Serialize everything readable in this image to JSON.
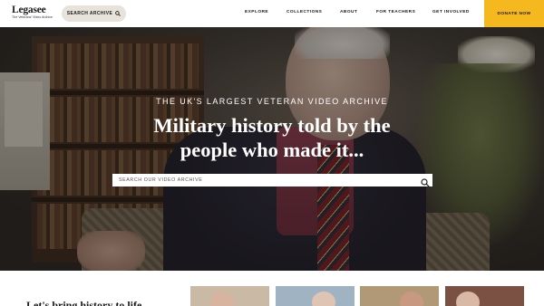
{
  "brand": {
    "name": "Legasee",
    "tagline": "The Veterans' Video Archive"
  },
  "header": {
    "search_label": "SEARCH ARCHIVE",
    "nav": [
      "EXPLORE",
      "COLLECTIONS",
      "ABOUT",
      "FOR TEACHERS",
      "GET INVOLVED"
    ],
    "donate_label": "DONATE NOW"
  },
  "hero": {
    "eyebrow": "THE UK'S LARGEST VETERAN VIDEO ARCHIVE",
    "title_line1": "Military history told by the",
    "title_line2": "people who made it...",
    "search_placeholder": "SEARCH OUR VIDEO ARCHIVE"
  },
  "intro": {
    "heading": "Let's bring history to life"
  },
  "thumbnails": [
    {
      "bg": "#c9b9a5",
      "face": "#d8b4a0"
    },
    {
      "bg": "#9fb3c2",
      "face": "#e0c4b3"
    },
    {
      "bg": "#b19876",
      "face": "#c99880"
    },
    {
      "bg": "#7b5144",
      "face": "#d9b9a6"
    }
  ],
  "colors": {
    "accent": "#f5b81f",
    "pill": "#e8e3da"
  },
  "icons": {
    "search": "search-icon"
  }
}
